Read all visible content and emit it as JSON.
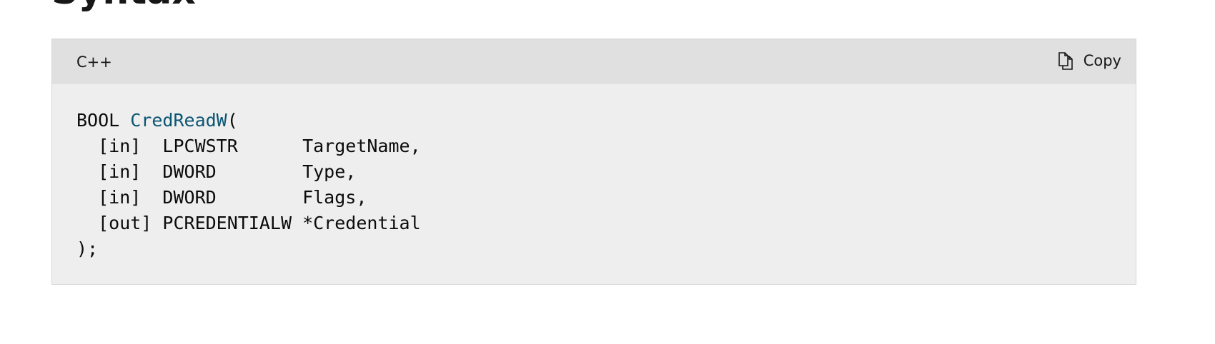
{
  "page": {
    "heading": "Syntax"
  },
  "code_block": {
    "language": "C++",
    "copy_label": "Copy",
    "copy_icon": "copy-icon",
    "function_name_color": "#0b5573",
    "lines": [
      {
        "prefix": "BOOL ",
        "function_name": "CredReadW",
        "suffix": "("
      },
      {
        "text": "  [in]  LPCWSTR      TargetName,"
      },
      {
        "text": "  [in]  DWORD        Type,"
      },
      {
        "text": "  [in]  DWORD        Flags,"
      },
      {
        "text": "  [out] PCREDENTIALW *Credential"
      },
      {
        "text": ");"
      }
    ]
  }
}
